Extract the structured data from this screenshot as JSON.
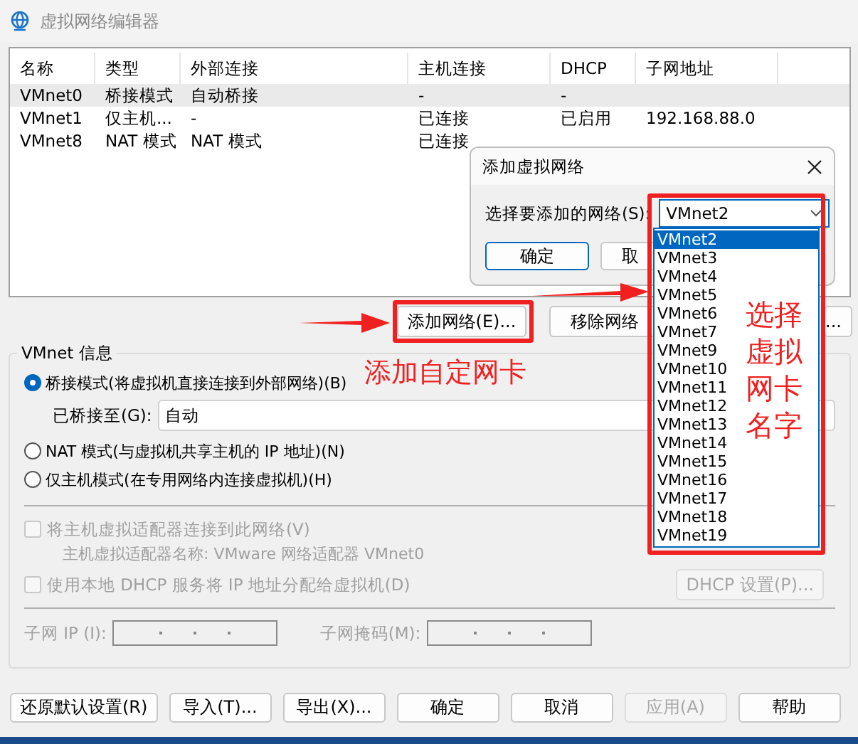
{
  "window": {
    "title": "虚拟网络编辑器"
  },
  "table": {
    "columns": [
      "名称",
      "类型",
      "外部连接",
      "主机连接",
      "DHCP",
      "子网地址"
    ],
    "rows": [
      {
        "cells": [
          "VMnet0",
          "桥接模式",
          "自动桥接",
          "-",
          "-"
        ],
        "selected": true
      },
      {
        "cells": [
          "VMnet1",
          "仅主机...",
          "-",
          "已连接",
          "已启用",
          "192.168.88.0"
        ],
        "selected": false
      },
      {
        "cells": [
          "VMnet8",
          "NAT 模式",
          "NAT 模式",
          "已连接"
        ],
        "selected": false
      }
    ]
  },
  "network_buttons": [
    "添加网络(E)...",
    "移除网络",
    "..."
  ],
  "vmnet_info": {
    "title": "VMnet 信息",
    "modes": [
      {
        "label": "桥接模式(将虚拟机直接连接到外部网络)(B)",
        "selected": true
      },
      {
        "label": "NAT 模式(与虚拟机共享主机的 IP 地址)(N)",
        "selected": false
      },
      {
        "label": "仅主机模式(在专用网络内连接虚拟机)(H)",
        "selected": false
      }
    ],
    "bridged_to": {
      "label": "已桥接至(G):",
      "value": "自动"
    },
    "host_adapter": {
      "label": "将主机虚拟适配器连接到此网络(V)",
      "checked": false,
      "disabled": true
    },
    "adapter_name": "主机虚拟适配器名称: VMware 网络适配器 VMnet0",
    "dhcp": {
      "label": "使用本地 DHCP 服务将 IP 地址分配给虚拟机(D)",
      "checked": false,
      "disabled": true
    },
    "dhcp_button": {
      "label": "DHCP 设置(P)...",
      "disabled": true
    },
    "subnet_ip": {
      "label": "子网 IP (I):",
      "disabled": true
    },
    "subnet_mask": {
      "label": "子网掩码(M):",
      "disabled": true
    }
  },
  "footer_buttons": [
    {
      "label": "还原默认设置(R)",
      "disabled": false
    },
    {
      "label": "导入(T)...",
      "disabled": false
    },
    {
      "label": "导出(X)...",
      "disabled": false
    },
    {
      "label": "确定",
      "disabled": false
    },
    {
      "label": "取消",
      "disabled": false
    },
    {
      "label": "应用(A)",
      "disabled": true
    },
    {
      "label": "帮助",
      "disabled": false
    }
  ],
  "dialog": {
    "title": "添加虚拟网络",
    "label": "选择要添加的网络(S):",
    "value": "VMnet2",
    "buttons": [
      "确定",
      "取"
    ],
    "options": [
      {
        "label": "VMnet2",
        "selected": true
      },
      {
        "label": "VMnet3",
        "selected": false
      },
      {
        "label": "VMnet4",
        "selected": false
      },
      {
        "label": "VMnet5",
        "selected": false
      },
      {
        "label": "VMnet6",
        "selected": false
      },
      {
        "label": "VMnet7",
        "selected": false
      },
      {
        "label": "VMnet9",
        "selected": false
      },
      {
        "label": "VMnet10",
        "selected": false
      },
      {
        "label": "VMnet11",
        "selected": false
      },
      {
        "label": "VMnet12",
        "selected": false
      },
      {
        "label": "VMnet13",
        "selected": false
      },
      {
        "label": "VMnet14",
        "selected": false
      },
      {
        "label": "VMnet15",
        "selected": false
      },
      {
        "label": "VMnet16",
        "selected": false
      },
      {
        "label": "VMnet17",
        "selected": false
      },
      {
        "label": "VMnet18",
        "selected": false
      },
      {
        "label": "VMnet19",
        "selected": false
      }
    ]
  },
  "annotations": [
    {
      "kind": "caption",
      "text": "添加自定网卡"
    },
    {
      "kind": "stacked",
      "text": "选择虚拟网卡名字"
    }
  ]
}
